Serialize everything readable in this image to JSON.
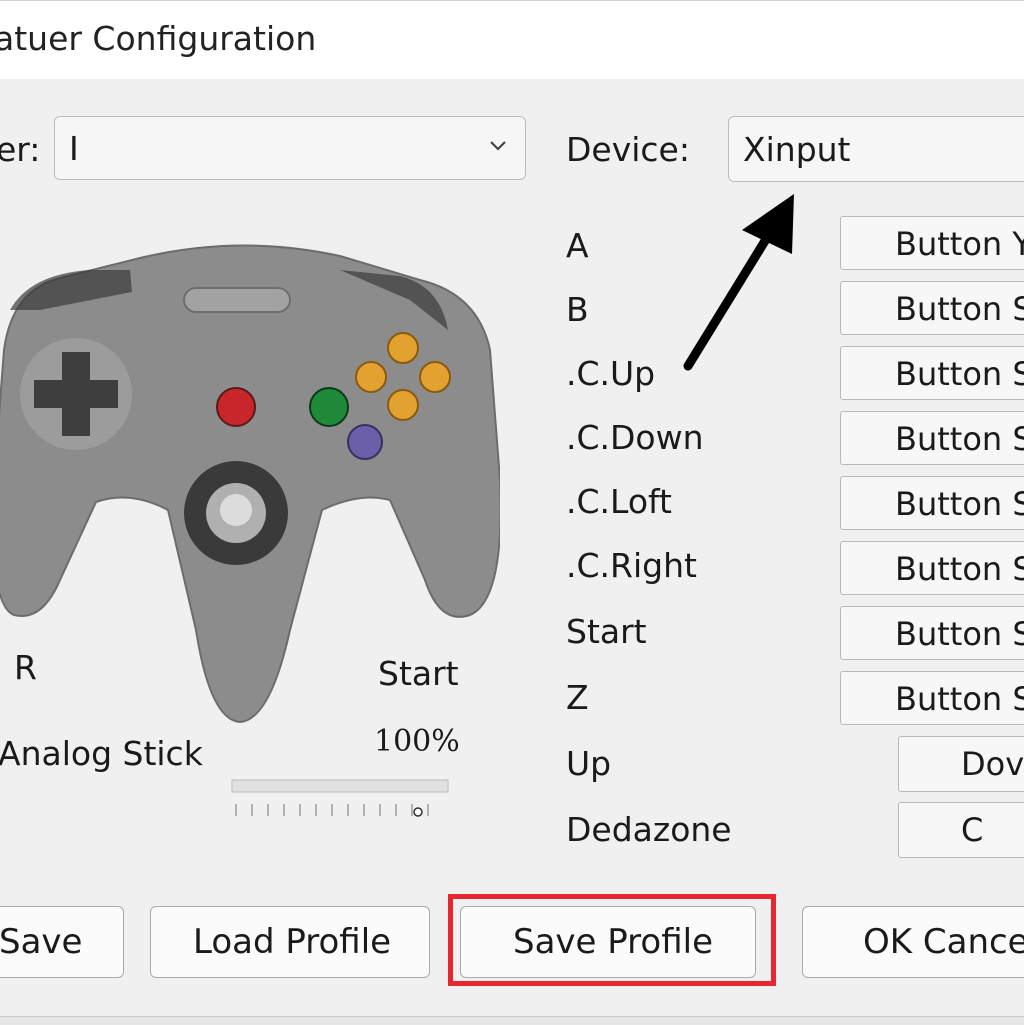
{
  "window": {
    "title": "atuer Configuration"
  },
  "player": {
    "label": "er:",
    "value": "I"
  },
  "device": {
    "label": "Device:",
    "value": "Xinput"
  },
  "mappings": [
    {
      "label": "A",
      "button": "Button Y"
    },
    {
      "label": "B",
      "button": "Button S"
    },
    {
      "label": ".C.Up",
      "button": "Button S"
    },
    {
      "label": ".C.Down",
      "button": "Button S"
    },
    {
      "label": ".C.Loft",
      "button": "Button S"
    },
    {
      "label": ".C.Right",
      "button": "Button S"
    },
    {
      "label": "Start",
      "button": "Button S"
    },
    {
      "label": "Z",
      "button": "Button S"
    },
    {
      "label": "Up",
      "button": "Dov"
    },
    {
      "label": "Dedazone",
      "button": "C"
    }
  ],
  "controller": {
    "left_label": "R",
    "right_label": "Start",
    "stick_label": "Analog Stick",
    "sensitivity_label": "100%",
    "sensitivity": 1.0
  },
  "buttons": {
    "save": "Save",
    "load_profile": "Load Profile",
    "save_profile": "Save Profile",
    "ok_cancel": "OK Cance"
  },
  "colors": {
    "highlight": "#e8262f",
    "controller_body": "#8c8c8c",
    "btn_red": "#c8262b",
    "btn_green": "#1f8a3a",
    "btn_purple": "#6a5fa8",
    "btn_yellow": "#e3a12f"
  },
  "icons": {
    "dropdown": "chevron-down-icon",
    "arrow": "arrow-up-right-icon",
    "controller": "n64-controller-image"
  }
}
